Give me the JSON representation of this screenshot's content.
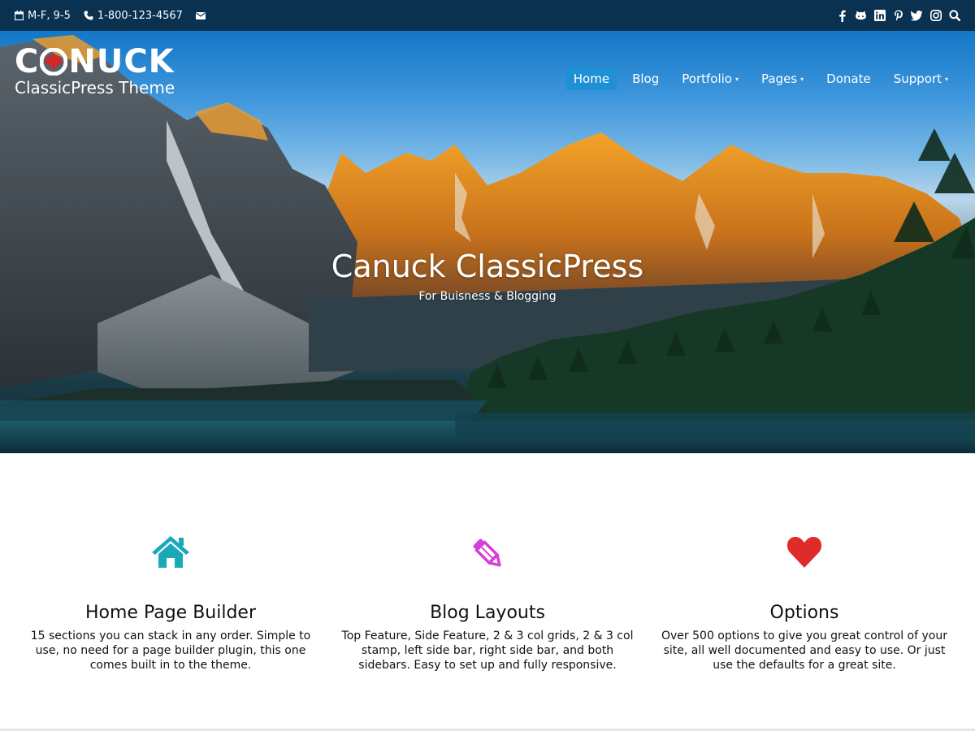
{
  "topbar": {
    "hours": "M-F, 9-5",
    "phone": "1-800-123-4567",
    "left_icons": [
      "calendar-icon",
      "phone-icon",
      "envelope-icon"
    ],
    "social_icons": [
      "facebook-icon",
      "github-icon",
      "linkedin-icon",
      "pinterest-icon",
      "twitter-icon",
      "instagram-icon",
      "search-icon"
    ]
  },
  "brand": {
    "logo_text_before": "C",
    "logo_text_after": "NUCK",
    "tagline": "ClassicPress Theme",
    "leaf_color": "#d7242b"
  },
  "nav": {
    "items": [
      {
        "label": "Home",
        "active": true,
        "has_dropdown": false
      },
      {
        "label": "Blog",
        "active": false,
        "has_dropdown": false
      },
      {
        "label": "Portfolio",
        "active": false,
        "has_dropdown": true
      },
      {
        "label": "Pages",
        "active": false,
        "has_dropdown": true
      },
      {
        "label": "Donate",
        "active": false,
        "has_dropdown": false
      },
      {
        "label": "Support",
        "active": false,
        "has_dropdown": true
      }
    ],
    "caret": "▾",
    "active_color": "#1e90d6"
  },
  "hero": {
    "title": "Canuck ClassicPress",
    "subtitle": "For Buisness & Blogging"
  },
  "features": [
    {
      "icon": "home-icon",
      "icon_color": "#1aa9b8",
      "title": "Home Page Builder",
      "text": "15 sections you can stack in any order. Simple to use, no need for a page builder plugin, this one comes built in to the theme."
    },
    {
      "icon": "pencil-icon",
      "icon_color": "#d63fd6",
      "title": "Blog Layouts",
      "text": "Top Feature, Side Feature, 2 & 3 col grids, 2 & 3 col stamp, left side bar, right side bar, and both sidebars. Easy to set up and fully responsive."
    },
    {
      "icon": "heart-icon",
      "icon_color": "#e02b2b",
      "title": "Options",
      "text": "Over 500 options to give you great control of your site, all well documented and easy to use. Or just use the defaults for a great site."
    }
  ],
  "colors": {
    "topbar_bg": "#0a3150"
  }
}
